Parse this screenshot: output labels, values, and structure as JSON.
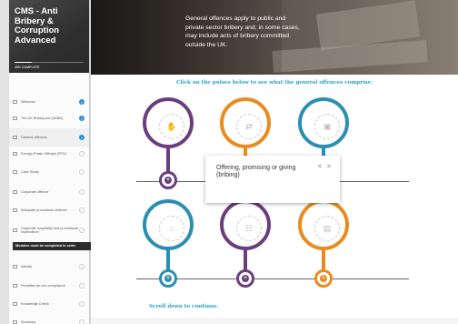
{
  "sidebar": {
    "title": "CMS - Anti Bribery & Corruption Advanced",
    "progress": "25% COMPLETE",
    "progress_fraction": 0.25,
    "items": [
      {
        "label": "Welcome",
        "status": "done"
      },
      {
        "label": "The UK Bribery Act (UKBA)",
        "status": "done"
      },
      {
        "label": "General offences",
        "status": "done",
        "active": true
      },
      {
        "label": "Foreign Public Officials (FPO)",
        "status": "open"
      },
      {
        "label": "Case Study",
        "status": "open"
      },
      {
        "label": "Corporate offence",
        "status": "open"
      },
      {
        "label": "Adequate procedures defence",
        "status": "open"
      },
      {
        "label": "Corporate hospitality and promotional expenditure",
        "status": "open"
      },
      {
        "label": "Activity",
        "status": "open"
      },
      {
        "label": "Penalties for non-compliance",
        "status": "open"
      },
      {
        "label": "Knowledge Check",
        "status": "open"
      },
      {
        "label": "Summary",
        "status": "open"
      }
    ],
    "tooltip": "Modules must be completed in order"
  },
  "banner": {
    "text": "General offences apply to public and private sector bribery and, in some cases, may include acts of bribery committed outside the UK."
  },
  "instruction": "Click on the pulses below to see what the general offences comprise:",
  "pins": [
    {
      "color": "#6a3d7c",
      "icon": "hand-offering-icon"
    },
    {
      "color": "#e98b1f",
      "icon": "people-exchange-icon"
    },
    {
      "color": "#2a8fb3",
      "icon": "gift-box-icon"
    },
    {
      "color": "#2a8fb3",
      "icon": "building-icon"
    },
    {
      "color": "#6a3d7c",
      "icon": "meeting-icon"
    },
    {
      "color": "#e98b1f",
      "icon": "document-icon"
    }
  ],
  "popup": {
    "text": "Offering, promising or giving (bribing)",
    "prev": "<",
    "next": ">"
  },
  "scroll_hint": "Scroll down to continue."
}
